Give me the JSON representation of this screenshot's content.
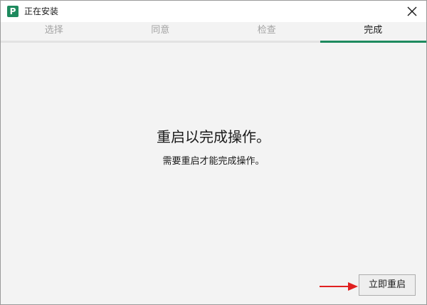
{
  "window": {
    "title": "正在安装",
    "icon": "installer-app-icon",
    "icon_glyph": "P",
    "close_icon": "close-icon"
  },
  "steps": {
    "items": [
      {
        "label": "选择"
      },
      {
        "label": "同意"
      },
      {
        "label": "检查"
      },
      {
        "label": "完成"
      }
    ],
    "active_index": 3,
    "colors": {
      "active_bar": "#1e8a5e",
      "inactive_text": "#a3a3a3",
      "active_text": "#1a1a1a"
    }
  },
  "content": {
    "heading": "重启以完成操作。",
    "subtext": "需要重启才能完成操作。"
  },
  "actions": {
    "restart_label": "立即重启",
    "annotation": {
      "icon": "red-arrow-icon",
      "color": "#e02020"
    }
  }
}
